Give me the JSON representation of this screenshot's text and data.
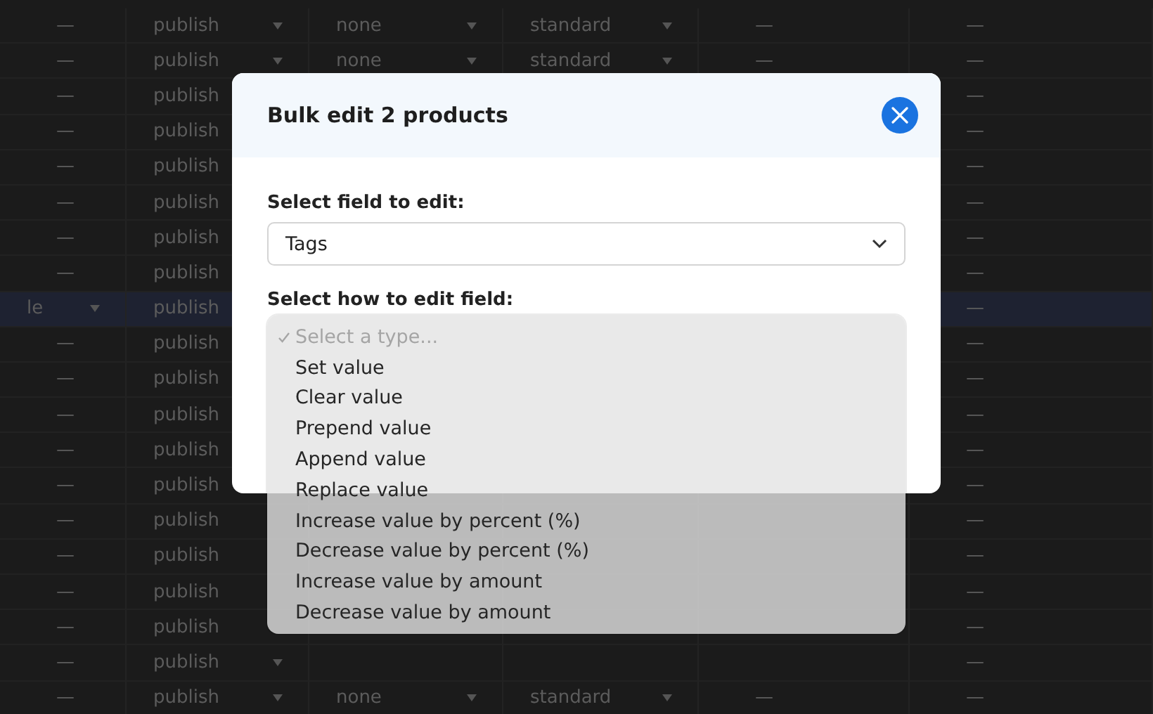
{
  "table": {
    "rows": [
      {
        "selected": false,
        "cells": [
          {
            "text": "—"
          },
          {
            "text": "publish",
            "caret": true
          },
          {
            "text": "none",
            "caret": true
          },
          {
            "text": "standard",
            "caret": true
          },
          {
            "text": "—"
          },
          {
            "text": "—"
          }
        ]
      },
      {
        "selected": false,
        "cells": [
          {
            "text": "—"
          },
          {
            "text": "publish",
            "caret": true
          },
          {
            "text": "none",
            "caret": true
          },
          {
            "text": "standard",
            "caret": true
          },
          {
            "text": "—"
          },
          {
            "text": "—"
          }
        ]
      },
      {
        "selected": false,
        "cells": [
          {
            "text": "—"
          },
          {
            "text": "publish",
            "caret": false
          },
          {},
          {},
          {},
          {
            "text": "—"
          }
        ]
      },
      {
        "selected": false,
        "cells": [
          {
            "text": "—"
          },
          {
            "text": "publish",
            "caret": false
          },
          {},
          {},
          {},
          {
            "text": "—"
          }
        ]
      },
      {
        "selected": false,
        "cells": [
          {
            "text": "—"
          },
          {
            "text": "publish",
            "caret": false
          },
          {},
          {},
          {},
          {
            "text": "—"
          }
        ]
      },
      {
        "selected": false,
        "cells": [
          {
            "text": "—"
          },
          {
            "text": "publish",
            "caret": false
          },
          {},
          {},
          {},
          {
            "text": "—"
          }
        ]
      },
      {
        "selected": false,
        "cells": [
          {
            "text": "—"
          },
          {
            "text": "publish",
            "caret": false
          },
          {},
          {},
          {},
          {
            "text": "—"
          }
        ]
      },
      {
        "selected": false,
        "cells": [
          {
            "text": "—"
          },
          {
            "text": "publish",
            "caret": false
          },
          {},
          {},
          {},
          {
            "text": "—"
          }
        ]
      },
      {
        "selected": true,
        "cells": [
          {
            "text": "le",
            "caret": true
          },
          {
            "text": "publish",
            "caret": false
          },
          {},
          {},
          {},
          {
            "text": "—"
          }
        ]
      },
      {
        "selected": false,
        "cells": [
          {
            "text": "—"
          },
          {
            "text": "publish",
            "caret": false
          },
          {},
          {},
          {},
          {
            "text": "—"
          }
        ]
      },
      {
        "selected": false,
        "cells": [
          {
            "text": "—"
          },
          {
            "text": "publish",
            "caret": false
          },
          {},
          {},
          {},
          {
            "text": "—"
          }
        ]
      },
      {
        "selected": false,
        "cells": [
          {
            "text": "—"
          },
          {
            "text": "publish",
            "caret": false
          },
          {},
          {},
          {},
          {
            "text": "—"
          }
        ]
      },
      {
        "selected": false,
        "cells": [
          {
            "text": "—"
          },
          {
            "text": "publish",
            "caret": false
          },
          {},
          {},
          {},
          {
            "text": "—"
          }
        ]
      },
      {
        "selected": false,
        "cells": [
          {
            "text": "—"
          },
          {
            "text": "publish",
            "caret": false
          },
          {},
          {},
          {},
          {
            "text": "—"
          }
        ]
      },
      {
        "selected": false,
        "cells": [
          {
            "text": "—"
          },
          {
            "text": "publish",
            "caret": false
          },
          {},
          {},
          {},
          {
            "text": "—"
          }
        ]
      },
      {
        "selected": false,
        "cells": [
          {
            "text": "—"
          },
          {
            "text": "publish",
            "caret": false
          },
          {},
          {},
          {},
          {
            "text": "—"
          }
        ]
      },
      {
        "selected": false,
        "cells": [
          {
            "text": "—"
          },
          {
            "text": "publish",
            "caret": false
          },
          {},
          {},
          {},
          {
            "text": "—"
          }
        ]
      },
      {
        "selected": false,
        "cells": [
          {
            "text": "—"
          },
          {
            "text": "publish",
            "caret": false
          },
          {},
          {},
          {},
          {
            "text": "—"
          }
        ]
      },
      {
        "selected": false,
        "cells": [
          {
            "text": "—"
          },
          {
            "text": "publish",
            "caret": true
          },
          {},
          {},
          {},
          {
            "text": "—"
          }
        ]
      },
      {
        "selected": false,
        "cells": [
          {
            "text": "—"
          },
          {
            "text": "publish",
            "caret": true
          },
          {
            "text": "none",
            "caret": true
          },
          {
            "text": "standard",
            "caret": true
          },
          {
            "text": "—"
          },
          {
            "text": "—"
          }
        ]
      }
    ]
  },
  "dialog": {
    "title": "Bulk edit 2 products",
    "field_label": "Select field to edit:",
    "field_value": "Tags",
    "mode_label": "Select how to edit field:",
    "menu": {
      "items": [
        {
          "label": "Select a type...",
          "selected": true,
          "disabled": true
        },
        {
          "label": "Set value",
          "selected": false,
          "disabled": false
        },
        {
          "label": "Clear value",
          "selected": false,
          "disabled": false
        },
        {
          "label": "Prepend value",
          "selected": false,
          "disabled": false
        },
        {
          "label": "Append value",
          "selected": false,
          "disabled": false
        },
        {
          "label": "Replace value",
          "selected": false,
          "disabled": false
        },
        {
          "label": "Increase value by percent (%)",
          "selected": false,
          "disabled": false
        },
        {
          "label": "Decrease value by percent (%)",
          "selected": false,
          "disabled": false
        },
        {
          "label": "Increase value by amount",
          "selected": false,
          "disabled": false
        },
        {
          "label": "Decrease value by amount",
          "selected": false,
          "disabled": false
        }
      ]
    }
  }
}
